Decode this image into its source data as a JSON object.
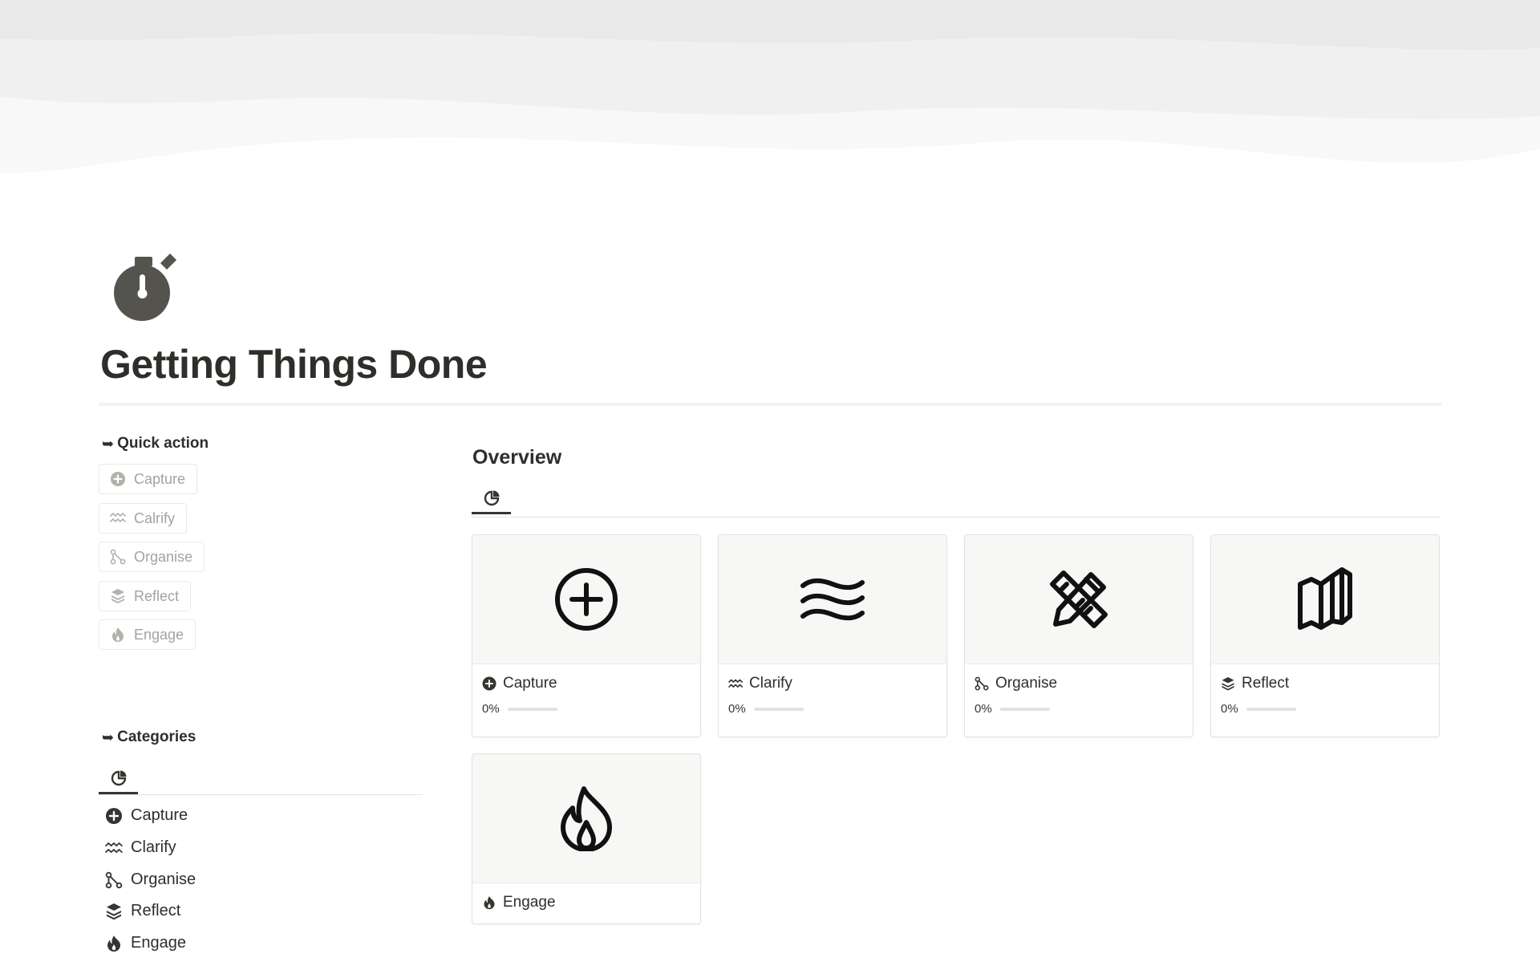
{
  "page": {
    "title": "Getting Things Done",
    "icon": "stopwatch-icon"
  },
  "colors": {
    "text": "#37352f",
    "muted": "#a5a39e",
    "icon_dark": "#55534e",
    "border": "#e3e2e0"
  },
  "quick_action": {
    "heading_arrow": "➥",
    "heading": "Quick action",
    "buttons": [
      {
        "label": "Capture",
        "icon": "plus-circle-icon"
      },
      {
        "label": "Calrify",
        "icon": "waves-icon"
      },
      {
        "label": "Organise",
        "icon": "share-nodes-icon"
      },
      {
        "label": "Reflect",
        "icon": "stack-icon"
      },
      {
        "label": "Engage",
        "icon": "flame-icon"
      }
    ]
  },
  "categories": {
    "heading_arrow": "➥",
    "heading": "Categories",
    "view_tab_icon": "chart-pie-icon",
    "items": [
      {
        "label": "Capture",
        "icon": "plus-circle-icon"
      },
      {
        "label": "Clarify",
        "icon": "waves-icon"
      },
      {
        "label": "Organise",
        "icon": "share-nodes-icon"
      },
      {
        "label": "Reflect",
        "icon": "stack-icon"
      },
      {
        "label": "Engage",
        "icon": "flame-icon"
      }
    ]
  },
  "overview": {
    "title": "Overview",
    "view_tab_icon": "chart-pie-icon",
    "cards": [
      {
        "name": "Capture",
        "icon": "plus-circle-icon",
        "progress_label": "0%",
        "progress": 0
      },
      {
        "name": "Clarify",
        "icon": "waves-icon",
        "progress_label": "0%",
        "progress": 0
      },
      {
        "name": "Organise",
        "icon": "pencil-ruler-icon",
        "progress_label": "0%",
        "progress": 0
      },
      {
        "name": "Reflect",
        "icon": "books-icon",
        "progress_label": "0%",
        "progress": 0
      },
      {
        "name": "Engage",
        "icon": "flame-icon"
      }
    ]
  }
}
